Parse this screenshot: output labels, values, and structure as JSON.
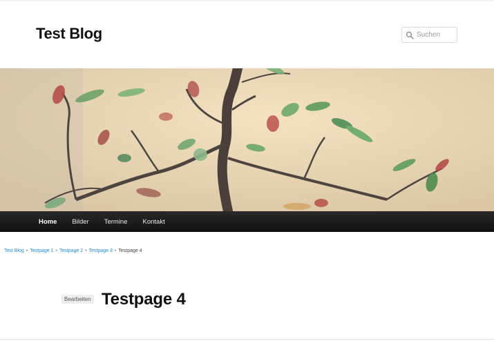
{
  "site": {
    "title": "Test Blog"
  },
  "search": {
    "placeholder": "Suchen"
  },
  "nav": {
    "items": [
      {
        "label": "Home"
      },
      {
        "label": "Bilder"
      },
      {
        "label": "Termine"
      },
      {
        "label": "Kontakt"
      }
    ]
  },
  "breadcrumb": {
    "items": [
      {
        "label": "Test Blog"
      },
      {
        "label": "Testpage 1"
      },
      {
        "label": "Testpage 2"
      },
      {
        "label": "Testpage 3"
      },
      {
        "label": "Testpage 4"
      }
    ],
    "separator": "•"
  },
  "page": {
    "edit_label": "Bearbeiten",
    "title": "Testpage 4"
  },
  "colors": {
    "nav_background": "#111111",
    "link": "#1b8be0"
  }
}
